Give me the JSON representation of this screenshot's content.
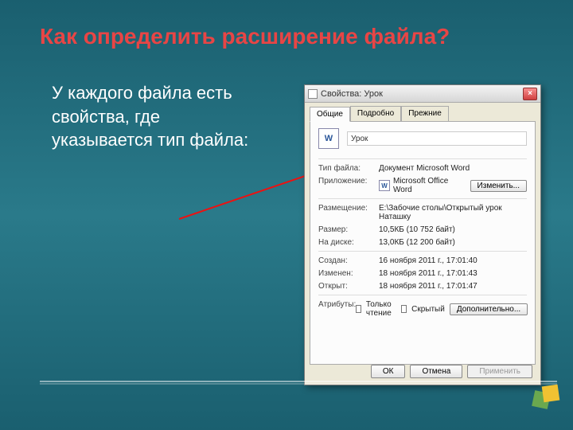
{
  "slide": {
    "title": "Как определить расширение файла?",
    "body": "У каждого файла есть свойства, где указывается тип файла:"
  },
  "dialog": {
    "title": "Свойства: Урок",
    "close": "×",
    "tabs": {
      "general": "Общие",
      "details": "Подробно",
      "previous": "Прежние"
    },
    "file_name": "Урок",
    "rows": {
      "type_label": "Тип файла:",
      "type_value": "Документ Microsoft Word",
      "app_label": "Приложение:",
      "app_value": "Microsoft Office Word",
      "change_btn": "Изменить...",
      "location_label": "Размещение:",
      "location_value": "E:\\Забочие столы\\Открытый урок Наташку",
      "size_label": "Размер:",
      "size_value": "10,5КБ (10 752 байт)",
      "ondisk_label": "На диске:",
      "ondisk_value": "13,0КБ (12 200 байт)",
      "created_label": "Создан:",
      "created_value": "16 ноября 2011 г., 17:01:40",
      "modified_label": "Изменен:",
      "modified_value": "18 ноября 2011 г., 17:01:43",
      "opened_label": "Открыт:",
      "opened_value": "18 ноября 2011 г., 17:01:47",
      "attrs_label": "Атрибуты:",
      "readonly": "Только чтение",
      "hidden": "Скрытый",
      "advanced": "Дополнительно..."
    },
    "buttons": {
      "ok": "ОК",
      "cancel": "Отмена",
      "apply": "Применить"
    }
  }
}
